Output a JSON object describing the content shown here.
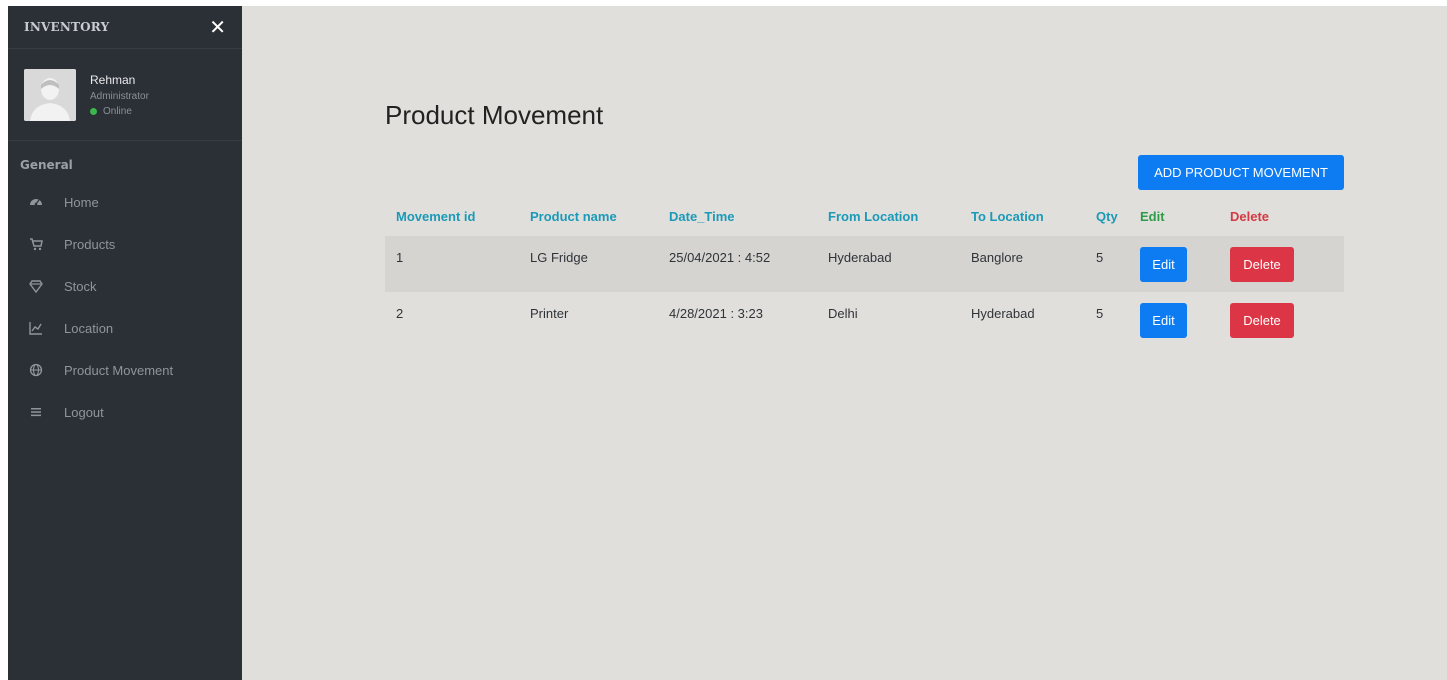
{
  "sidebar": {
    "brand": "INVENTORY",
    "close_icon": "close-icon",
    "user": {
      "name": "Rehman",
      "role": "Administrator",
      "status": "Online",
      "status_color": "#3cb54a"
    },
    "section_title": "General",
    "items": [
      {
        "label": "Home",
        "icon": "dashboard-icon"
      },
      {
        "label": "Products",
        "icon": "cart-icon"
      },
      {
        "label": "Stock",
        "icon": "diamond-icon"
      },
      {
        "label": "Location",
        "icon": "chart-icon"
      },
      {
        "label": "Product Movement",
        "icon": "globe-icon"
      },
      {
        "label": "Logout",
        "icon": "menu-icon"
      }
    ]
  },
  "main": {
    "title": "Product Movement",
    "add_button_label": "ADD PRODUCT MOVEMENT",
    "table": {
      "headers": [
        "Movement id",
        "Product name",
        "Date_Time",
        "From Location",
        "To Location",
        "Qty",
        "Edit",
        "Delete"
      ],
      "rows": [
        {
          "id": "1",
          "product": "LG Fridge",
          "datetime": "25/04/2021 : 4:52",
          "from": "Hyderabad",
          "to": "Banglore",
          "qty": "5",
          "edit": "Edit",
          "delete": "Delete"
        },
        {
          "id": "2",
          "product": "Printer",
          "datetime": "4/28/2021 : 3:23",
          "from": "Delhi",
          "to": "Hyderabad",
          "qty": "5",
          "edit": "Edit",
          "delete": "Delete"
        }
      ]
    }
  },
  "colors": {
    "sidebar_bg": "#2b2f36",
    "page_bg": "#e0dfdc",
    "primary": "#0d7bf2",
    "danger": "#dc3545",
    "header_teal": "#1b9ab8",
    "header_green": "#2f9b48"
  }
}
